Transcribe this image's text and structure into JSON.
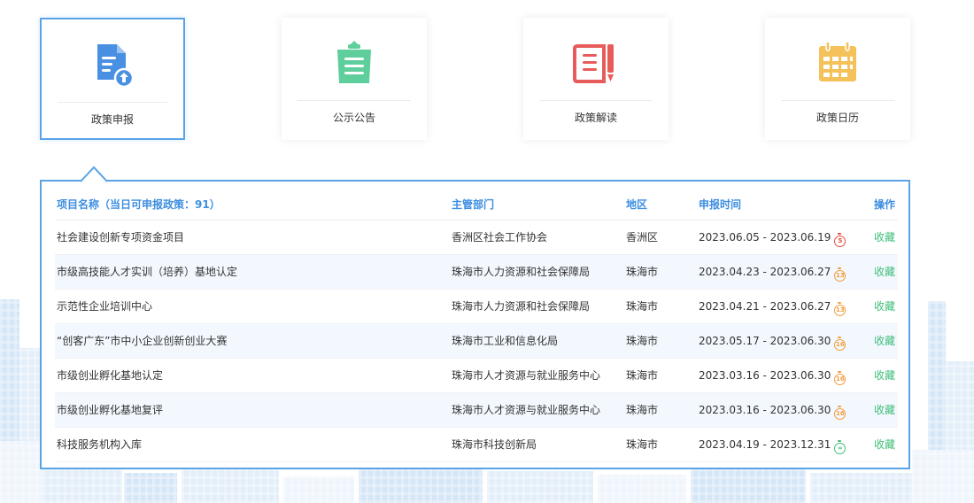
{
  "nav": {
    "cards": [
      {
        "label": "政策申报",
        "icon": "document-upload-icon",
        "active": true
      },
      {
        "label": "公示公告",
        "icon": "clipboard-list-icon",
        "active": false
      },
      {
        "label": "政策解读",
        "icon": "book-pen-icon",
        "active": false
      },
      {
        "label": "政策日历",
        "icon": "calendar-icon",
        "active": false
      }
    ]
  },
  "colors": {
    "accent": "#5aa3e6",
    "upload": "#4a90e2",
    "clipboard": "#5ecf9c",
    "book": "#e85b5b",
    "calendar": "#f5c15a",
    "action": "#3fbe7a"
  },
  "table": {
    "headers": {
      "name": "项目名称（当日可申报政策：91）",
      "dept": "主管部门",
      "region": "地区",
      "time": "申报时间",
      "action": "操作"
    },
    "rows": [
      {
        "name": "社会建设创新专项资金项目",
        "dept": "香洲区社会工作协会",
        "region": "香洲区",
        "time": "2023.06.05 - 2023.06.19",
        "days": "5",
        "badge_color": "#e74c3c",
        "action": "收藏"
      },
      {
        "name": "市级高技能人才实训（培养）基地认定",
        "dept": "珠海市人力资源和社会保障局",
        "region": "珠海市",
        "time": "2023.04.23 - 2023.06.27",
        "days": "13",
        "badge_color": "#f39c3a",
        "action": "收藏"
      },
      {
        "name": "示范性企业培训中心",
        "dept": "珠海市人力资源和社会保障局",
        "region": "珠海市",
        "time": "2023.04.21 - 2023.06.27",
        "days": "13",
        "badge_color": "#f39c3a",
        "action": "收藏"
      },
      {
        "name": "“创客广东”市中小企业创新创业大赛",
        "dept": "珠海市工业和信息化局",
        "region": "珠海市",
        "time": "2023.05.17 - 2023.06.30",
        "days": "16",
        "badge_color": "#f39c3a",
        "action": "收藏"
      },
      {
        "name": "市级创业孵化基地认定",
        "dept": "珠海市人才资源与就业服务中心",
        "region": "珠海市",
        "time": "2023.03.16 - 2023.06.30",
        "days": "16",
        "badge_color": "#f39c3a",
        "action": "收藏"
      },
      {
        "name": "市级创业孵化基地复评",
        "dept": "珠海市人才资源与就业服务中心",
        "region": "珠海市",
        "time": "2023.03.16 - 2023.06.30",
        "days": "16",
        "badge_color": "#f39c3a",
        "action": "收藏"
      },
      {
        "name": "科技服务机构入库",
        "dept": "珠海市科技创新局",
        "region": "珠海市",
        "time": "2023.04.19 - 2023.12.31",
        "days": "∞",
        "badge_color": "#3fbe7a",
        "action": "收藏"
      }
    ]
  }
}
